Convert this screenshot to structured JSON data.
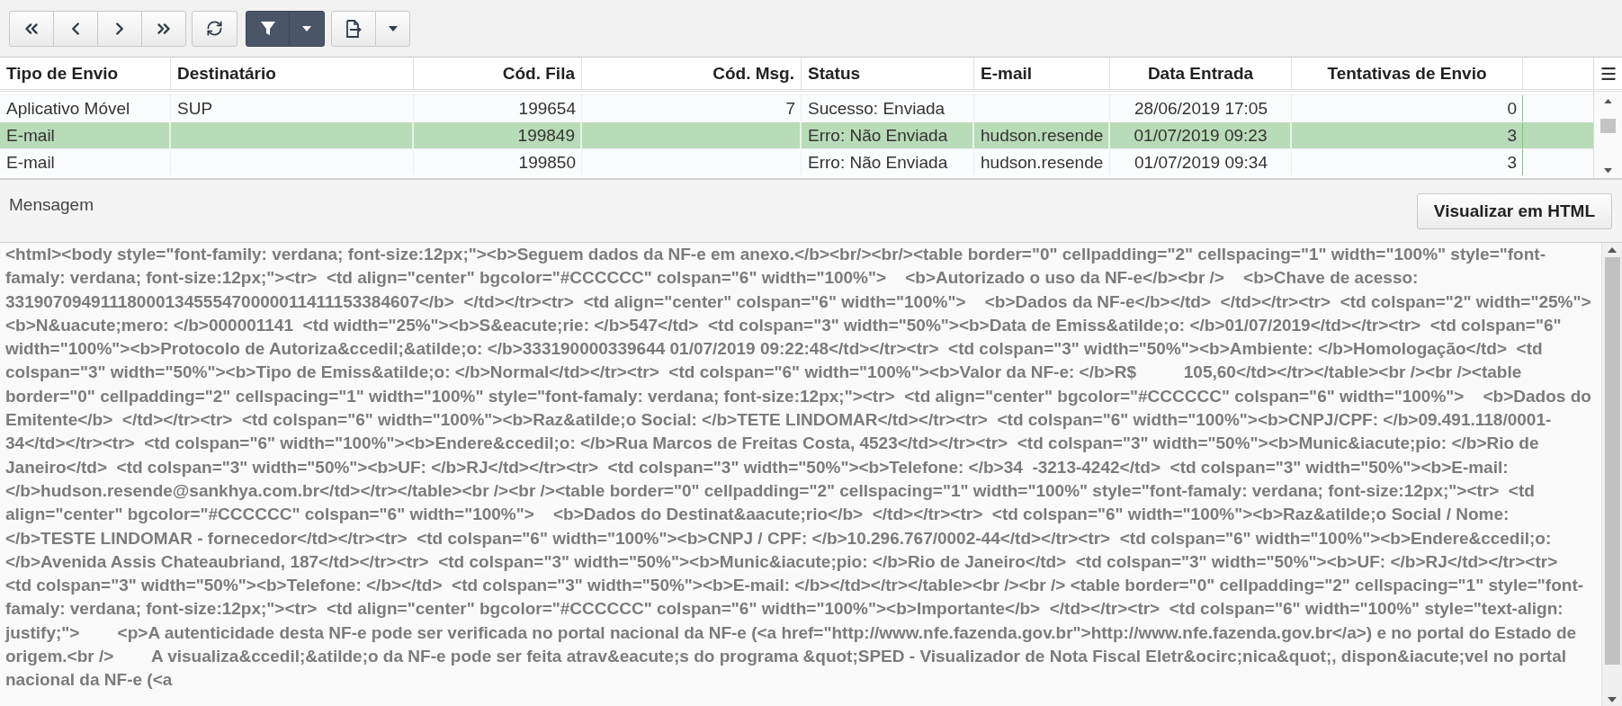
{
  "toolbar": {
    "filter_on": true
  },
  "table": {
    "columns": [
      "Tipo de Envio",
      "Destinatário",
      "Cód. Fila",
      "Cód. Msg.",
      "Status",
      "E-mail",
      "Data Entrada",
      "Tentativas de Envio"
    ],
    "rows": [
      {
        "selected": false,
        "tipo_de_envio": "Aplicativo Móvel",
        "destinatario": "SUP",
        "cod_fila": "199654",
        "cod_msg": "7",
        "status": "Sucesso: Enviada",
        "data_entrada": "28/06/2019 17:05",
        "tentativas_de_envio": "0"
      },
      {
        "selected": true,
        "tipo_de_envio": "E-mail",
        "cod_fila": "199849",
        "status": "Erro: Não Enviada",
        "email": "hudson.resende",
        "data_entrada": "01/07/2019 09:23",
        "tentativas_de_envio": "3"
      },
      {
        "selected": false,
        "tipo_de_envio": "E-mail",
        "cod_fila": "199850",
        "status": "Erro: Não Enviada",
        "email": "hudson.resende",
        "data_entrada": "01/07/2019 09:34",
        "tentativas_de_envio": "3"
      }
    ]
  },
  "message": {
    "label": "Mensagem",
    "view_button": "Visualizar em HTML",
    "value": "<html><body style=\"font-family: verdana; font-size:12px;\"><b>Seguem dados da NF-e em anexo.</b><br/><br/><table border=\"0\" cellpadding=\"2\" cellspacing=\"1\" width=\"100%\" style=\"font-famaly: verdana; font-size:12px;\"><tr>  <td align=\"center\" bgcolor=\"#CCCCCC\" colspan=\"6\" width=\"100%\">    <b>Autorizado o uso da NF-e</b><br />    <b>Chave de acesso: 33190709491118000134555470000011411153384607</b>  </td></tr><tr>  <td align=\"center\" colspan=\"6\" width=\"100%\">    <b>Dados da NF-e</b></td>  </td></tr><tr>  <td colspan=\"2\" width=\"25%\"><b>N&uacute;mero: </b>000001141  <td width=\"25%\"><b>S&eacute;rie: </b>547</td>  <td colspan=\"3\" width=\"50%\"><b>Data de Emiss&atilde;o: </b>01/07/2019</td></tr><tr>  <td colspan=\"6\" width=\"100%\"><b>Protocolo de Autoriza&ccedil;&atilde;o: </b>333190000339644 01/07/2019 09:22:48</td></tr><tr>  <td colspan=\"3\" width=\"50%\"><b>Ambiente: </b>Homologação</td>  <td colspan=\"3\" width=\"50%\"><b>Tipo de Emiss&atilde;o: </b>Normal</td></tr><tr>  <td colspan=\"6\" width=\"100%\"><b>Valor da NF-e: </b>R$          105,60</td></tr></table><br /><br /><table border=\"0\" cellpadding=\"2\" cellspacing=\"1\" width=\"100%\" style=\"font-famaly: verdana; font-size:12px;\"><tr>  <td align=\"center\" bgcolor=\"#CCCCCC\" colspan=\"6\" width=\"100%\">    <b>Dados do Emitente</b>  </td></tr><tr>  <td colspan=\"6\" width=\"100%\"><b>Raz&atilde;o Social: </b>TETE LINDOMAR</td></tr><tr>  <td colspan=\"6\" width=\"100%\"><b>CNPJ/CPF: </b>09.491.118/0001-34</td></tr><tr>  <td colspan=\"6\" width=\"100%\"><b>Endere&ccedil;o: </b>Rua Marcos de Freitas Costa, 4523</td></tr><tr>  <td colspan=\"3\" width=\"50%\"><b>Munic&iacute;pio: </b>Rio de Janeiro</td>  <td colspan=\"3\" width=\"50%\"><b>UF: </b>RJ</td></tr><tr>  <td colspan=\"3\" width=\"50%\"><b>Telefone: </b>34  -3213-4242</td>  <td colspan=\"3\" width=\"50%\"><b>E-mail: </b>hudson.resende@sankhya.com.br</td></tr></table><br /><br /><table border=\"0\" cellpadding=\"2\" cellspacing=\"1\" width=\"100%\" style=\"font-famaly: verdana; font-size:12px;\"><tr>  <td align=\"center\" bgcolor=\"#CCCCCC\" colspan=\"6\" width=\"100%\">    <b>Dados do Destinat&aacute;rio</b>  </td></tr><tr>  <td colspan=\"6\" width=\"100%\"><b>Raz&atilde;o Social / Nome: </b>TESTE LINDOMAR - fornecedor</td></tr><tr>  <td colspan=\"6\" width=\"100%\"><b>CNPJ / CPF: </b>10.296.767/0002-44</td></tr><tr>  <td colspan=\"6\" width=\"100%\"><b>Endere&ccedil;o: </b>Avenida Assis Chateaubriand, 187</td></tr><tr>  <td colspan=\"3\" width=\"50%\"><b>Munic&iacute;pio: </b>Rio de Janeiro</td>  <td colspan=\"3\" width=\"50%\"><b>UF: </b>RJ</td></tr><tr>  <td colspan=\"3\" width=\"50%\"><b>Telefone: </b></td>  <td colspan=\"3\" width=\"50%\"><b>E-mail: </b></td></tr></table><br /><br /> <table border=\"0\" cellpadding=\"2\" cellspacing=\"1\" style=\"font-famaly: verdana; font-size:12px;\"><tr>  <td align=\"center\" bgcolor=\"#CCCCCC\" colspan=\"6\" width=\"100%\"><b>Importante</b>  </td></tr><tr>  <td colspan=\"6\" width=\"100%\" style=\"text-align: justify;\">        <p>A autenticidade desta NF-e pode ser verificada no portal nacional da NF-e (<a href=\"http://www.nfe.fazenda.gov.br\">http://www.nfe.fazenda.gov.br</a>) e no portal do Estado de origem.<br />        A visualiza&ccedil;&atilde;o da NF-e pode ser feita atrav&eacute;s do programa &quot;SPED - Visualizador de Nota Fiscal Eletr&ocirc;nica&quot;, dispon&iacute;vel no portal nacional da NF-e (<a"
  }
}
